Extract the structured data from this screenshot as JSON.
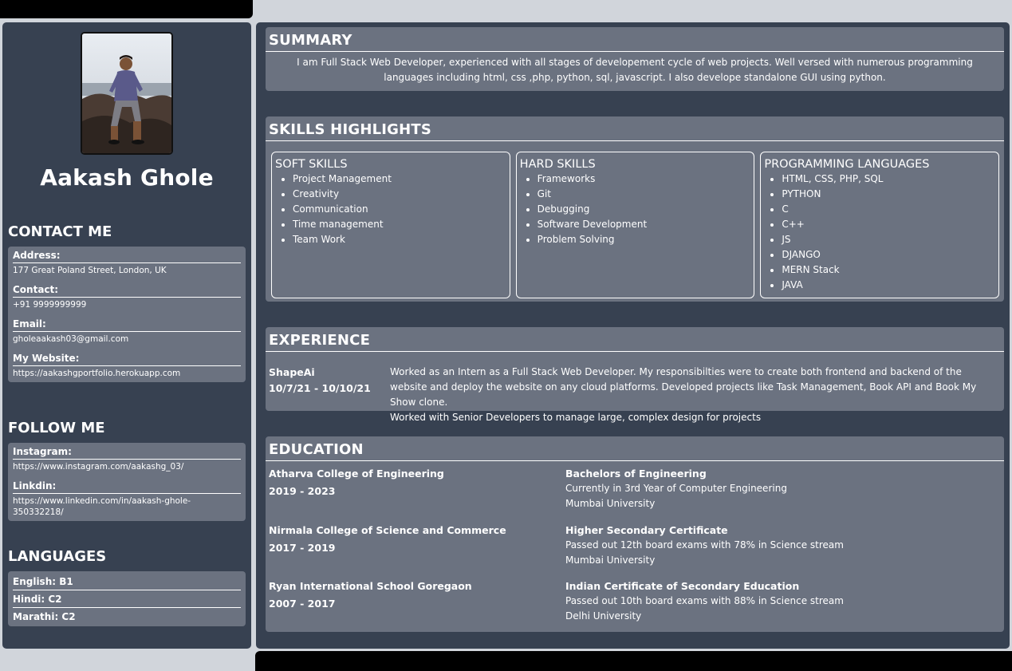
{
  "profile": {
    "name": "Aakash Ghole"
  },
  "contact": {
    "heading": "CONTACT ME",
    "fields": [
      {
        "label": "Address:",
        "value": "177 Great Poland Street, London, UK"
      },
      {
        "label": "Contact:",
        "value": "+91 9999999999"
      },
      {
        "label": "Email:",
        "value": "gholeaakash03@gmail.com"
      },
      {
        "label": "My Website:",
        "value": "https://aakashgportfolio.herokuapp.com"
      }
    ]
  },
  "follow": {
    "heading": "FOLLOW ME",
    "fields": [
      {
        "label": "Instagram:",
        "value": "https://www.instagram.com/aakashg_03/"
      },
      {
        "label": "Linkdin:",
        "value": "https://www.linkedin.com/in/aakash-ghole-350332218/"
      }
    ]
  },
  "languages": {
    "heading": "LANGUAGES",
    "items": [
      "English: B1",
      "Hindi: C2",
      "Marathi: C2"
    ]
  },
  "summary": {
    "title": "SUMMARY",
    "text": "I am Full Stack Web Developer, experienced with all stages of developement cycle of web projects. Well versed with numerous programming languages including html, css ,php, python, sql, javascript. I also develope standalone GUI using python."
  },
  "skills": {
    "title": "SKILLS HIGHLIGHTS",
    "groups": [
      {
        "title": "SOFT SKILLS",
        "items": [
          "Project Management",
          "Creativity",
          "Communication",
          "Time management",
          "Team Work"
        ]
      },
      {
        "title": "HARD SKILLS",
        "items": [
          "Frameworks",
          "Git",
          "Debugging",
          "Software Development",
          "Problem Solving"
        ]
      },
      {
        "title": "PROGRAMMING LANGUAGES",
        "items": [
          "HTML, CSS, PHP, SQL",
          "PYTHON",
          "C",
          "C++",
          "JS",
          "DJANGO",
          "MERN Stack",
          "JAVA"
        ]
      }
    ]
  },
  "experience": {
    "title": "EXPERIENCE",
    "company": "ShapeAi",
    "dates": "10/7/21 - 10/10/21",
    "description": "Worked as an Intern as a Full Stack Web Developer. My responsibilties were to create both frontend and backend of the website and deploy the website on any cloud platforms. Developed projects like Task Management, Book API and Book My Show clone.",
    "description2": "Worked with Senior Developers to manage large, complex design for projects"
  },
  "education": {
    "title": "EDUCATION",
    "entries": [
      {
        "school": "Atharva College of Engineering",
        "years": "2019 - 2023",
        "degree": "Bachelors of Engineering",
        "line1": "Currently in 3rd Year of Computer Engineering",
        "line2": "Mumbai University"
      },
      {
        "school": "Nirmala College of Science and Commerce",
        "years": "2017 - 2019",
        "degree": "Higher Secondary Certificate",
        "line1": "Passed out 12th board exams with 78% in Science stream",
        "line2": "Mumbai University"
      },
      {
        "school": "Ryan International School Goregaon",
        "years": "2007 - 2017",
        "degree": "Indian Certificate of Secondary Education",
        "line1": "Passed out 10th board exams with 88% in Science stream",
        "line2": "Delhi University"
      }
    ]
  }
}
